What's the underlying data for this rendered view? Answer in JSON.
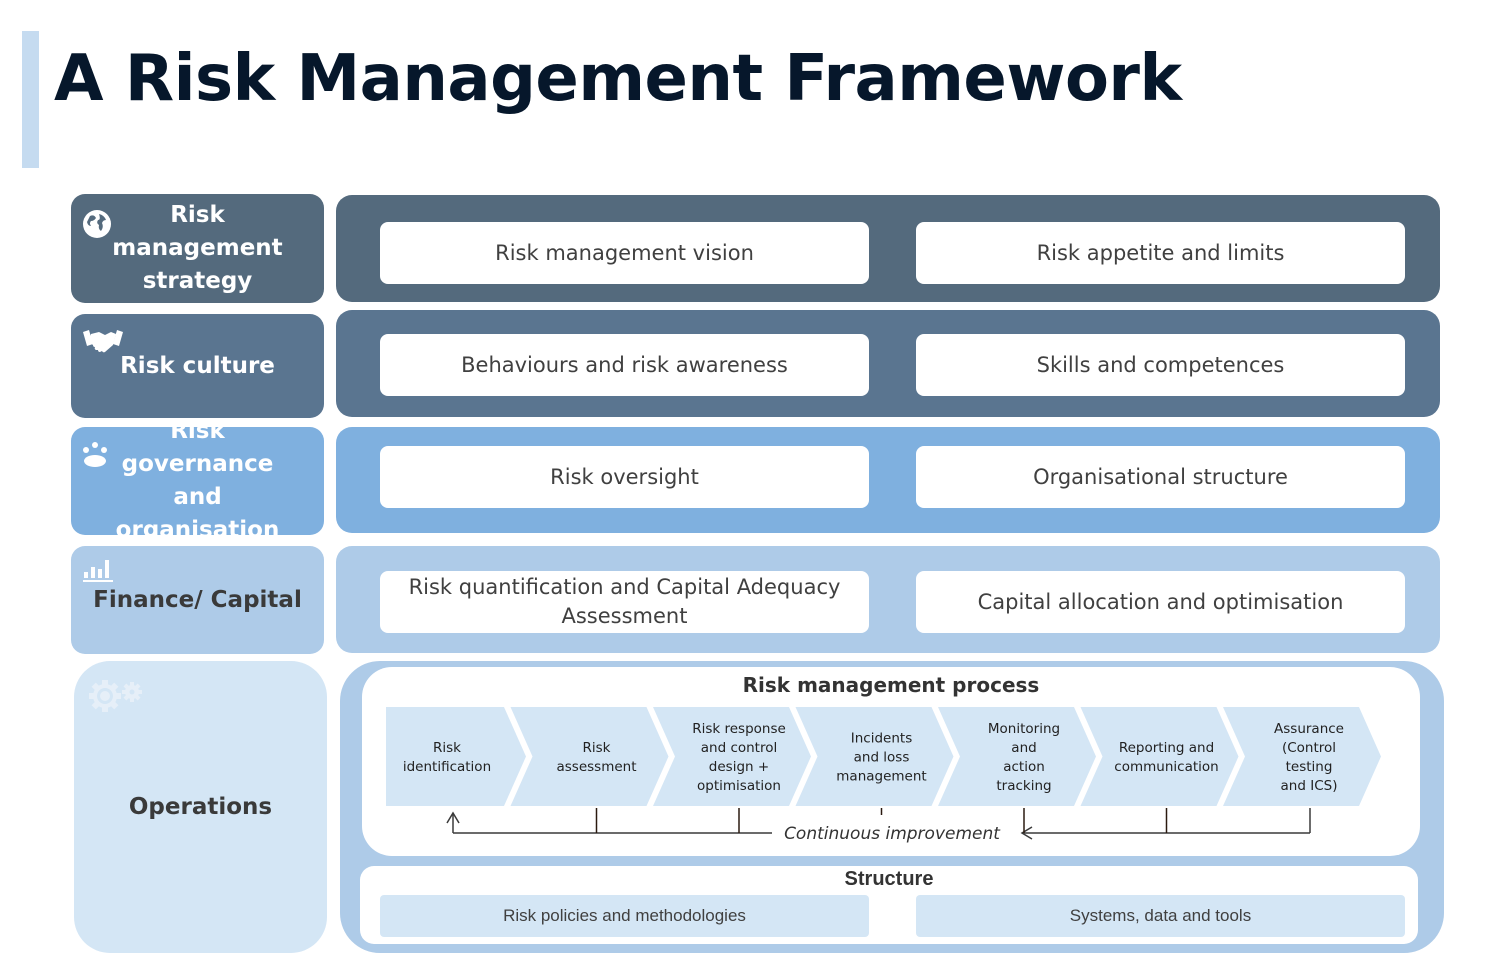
{
  "title": "A Risk Management Framework",
  "colors": {
    "strategy": "#546a7d",
    "culture": "#5a7590",
    "governance": "#7fb0df",
    "finance": "#aecbe8",
    "operations": "#d4e6f5",
    "title": "#06172b",
    "accent_bar": "#c5dbf0"
  },
  "rows": [
    {
      "label": "Risk management strategy",
      "icon": "globe-icon",
      "items": [
        "Risk management vision",
        "Risk appetite and limits"
      ]
    },
    {
      "label": "Risk culture",
      "icon": "handshake-icon",
      "items": [
        "Behaviours and risk awareness",
        "Skills and competences"
      ]
    },
    {
      "label": "Risk governance and organisation",
      "icon": "team-meeting-icon",
      "items": [
        "Risk oversight",
        "Organisational structure"
      ]
    },
    {
      "label": "Finance/ Capital",
      "icon": "bar-chart-icon",
      "items": [
        "Risk quantification and Capital Adequacy Assessment",
        "Capital allocation and optimisation"
      ]
    }
  ],
  "operations": {
    "label": "Operations",
    "icon": "gears-icon",
    "process": {
      "title": "Risk management process",
      "steps": [
        [
          "Risk",
          "identification"
        ],
        [
          "Risk",
          "assessment"
        ],
        [
          "Risk response",
          "and control",
          "design +",
          "optimisation"
        ],
        [
          "Incidents",
          "and loss",
          "management"
        ],
        [
          "Monitoring",
          "and",
          "action",
          "tracking"
        ],
        [
          "Reporting and",
          "communication"
        ],
        [
          "Assurance",
          "(Control",
          "testing",
          "and ICS)"
        ]
      ],
      "feedback_label": "Continuous improvement"
    },
    "structure": {
      "title": "Structure",
      "items": [
        "Risk policies and methodologies",
        "Systems, data and tools"
      ]
    }
  }
}
